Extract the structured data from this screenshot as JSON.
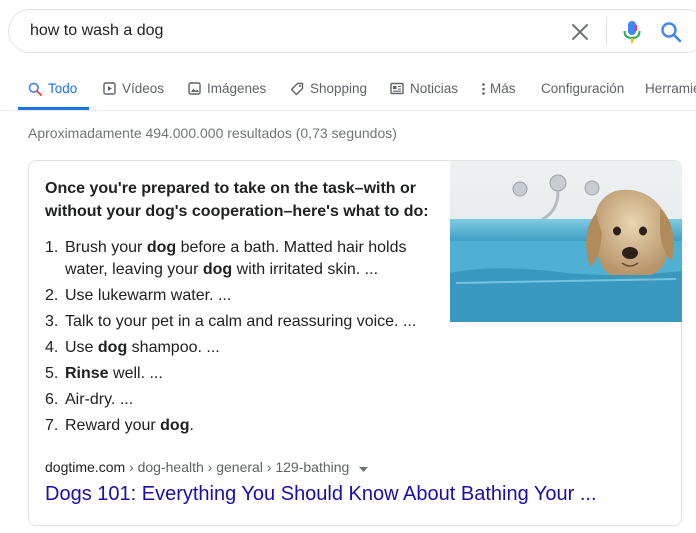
{
  "search": {
    "query": "how to wash a dog"
  },
  "tabs": [
    {
      "label": "Todo",
      "icon": "search-icon",
      "active": true
    },
    {
      "label": "Vídeos",
      "icon": "video-icon"
    },
    {
      "label": "Imágenes",
      "icon": "image-icon"
    },
    {
      "label": "Shopping",
      "icon": "tag-icon"
    },
    {
      "label": "Noticias",
      "icon": "news-icon"
    },
    {
      "label": "Más",
      "icon": "more-vert-icon"
    },
    {
      "label": "Configuración"
    },
    {
      "label": "Herramientas"
    }
  ],
  "stats": "Aproximadamente 494.000.000 resultados (0,73 segundos)",
  "snippet": {
    "heading": "Once you're prepared to take on the task–with or without your dog's cooperation–here's what to do:",
    "steps": [
      {
        "num": "1.",
        "parts": [
          [
            "Brush your ",
            false
          ],
          [
            "dog",
            true
          ],
          [
            " before a bath. Matted hair holds water, leaving your ",
            false
          ],
          [
            "dog",
            true
          ],
          [
            " with irritated skin. ...",
            false
          ]
        ]
      },
      {
        "num": "2.",
        "parts": [
          [
            "Use lukewarm water. ...",
            false
          ]
        ]
      },
      {
        "num": "3.",
        "parts": [
          [
            "Talk to your pet in a calm and reassuring voice. ...",
            false
          ]
        ]
      },
      {
        "num": "4.",
        "parts": [
          [
            "Use ",
            false
          ],
          [
            "dog",
            true
          ],
          [
            " shampoo. ...",
            false
          ]
        ]
      },
      {
        "num": "5.",
        "parts": [
          [
            "Rinse",
            true
          ],
          [
            " well. ...",
            false
          ]
        ]
      },
      {
        "num": "6.",
        "parts": [
          [
            "Air-dry. ...",
            false
          ]
        ]
      },
      {
        "num": "7.",
        "parts": [
          [
            "Reward your ",
            false
          ],
          [
            "dog",
            true
          ],
          [
            ".",
            false
          ]
        ]
      }
    ],
    "cite_domain": "dogtime.com",
    "cite_path": " › dog-health › general › 129-bathing",
    "link_title": "Dogs 101: Everything You Should Know About Bathing Your ..."
  },
  "colors": {
    "accent": "#1a73e8",
    "link": "#1a0dab",
    "tub": "#5bb7d6"
  }
}
